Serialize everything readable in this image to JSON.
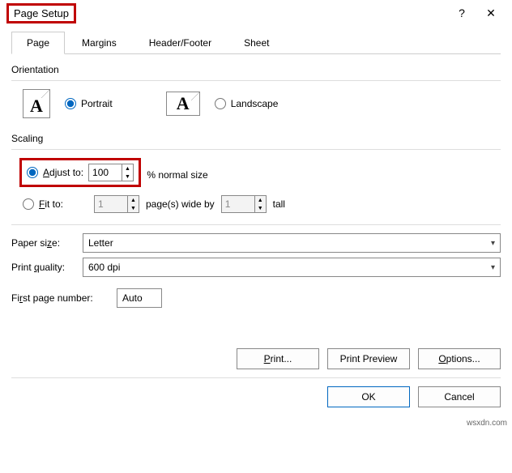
{
  "title": "Page Setup",
  "help_glyph": "?",
  "close_glyph": "✕",
  "tabs": {
    "page": "Page",
    "margins": "Margins",
    "headerfooter": "Header/Footer",
    "sheet": "Sheet"
  },
  "orientation": {
    "label": "Orientation",
    "portrait": "Portrait",
    "landscape": "Landscape"
  },
  "scaling": {
    "label": "Scaling",
    "adjust_to": "Adjust to:",
    "adjust_value": "100",
    "normal_size": "% normal size",
    "fit_to": "Fit to:",
    "fit_wide_value": "1",
    "pages_wide_by": "page(s) wide by",
    "fit_tall_value": "1",
    "tall": "tall"
  },
  "paper": {
    "size_label": "Paper size:",
    "size_value": "Letter",
    "quality_label": "Print quality:",
    "quality_value": "600 dpi"
  },
  "first_page": {
    "label": "First page number:",
    "value": "Auto"
  },
  "buttons": {
    "print": "Print...",
    "print_preview": "Print Preview",
    "options": "Options...",
    "ok": "OK",
    "cancel": "Cancel"
  },
  "watermark": "wsxdn.com"
}
